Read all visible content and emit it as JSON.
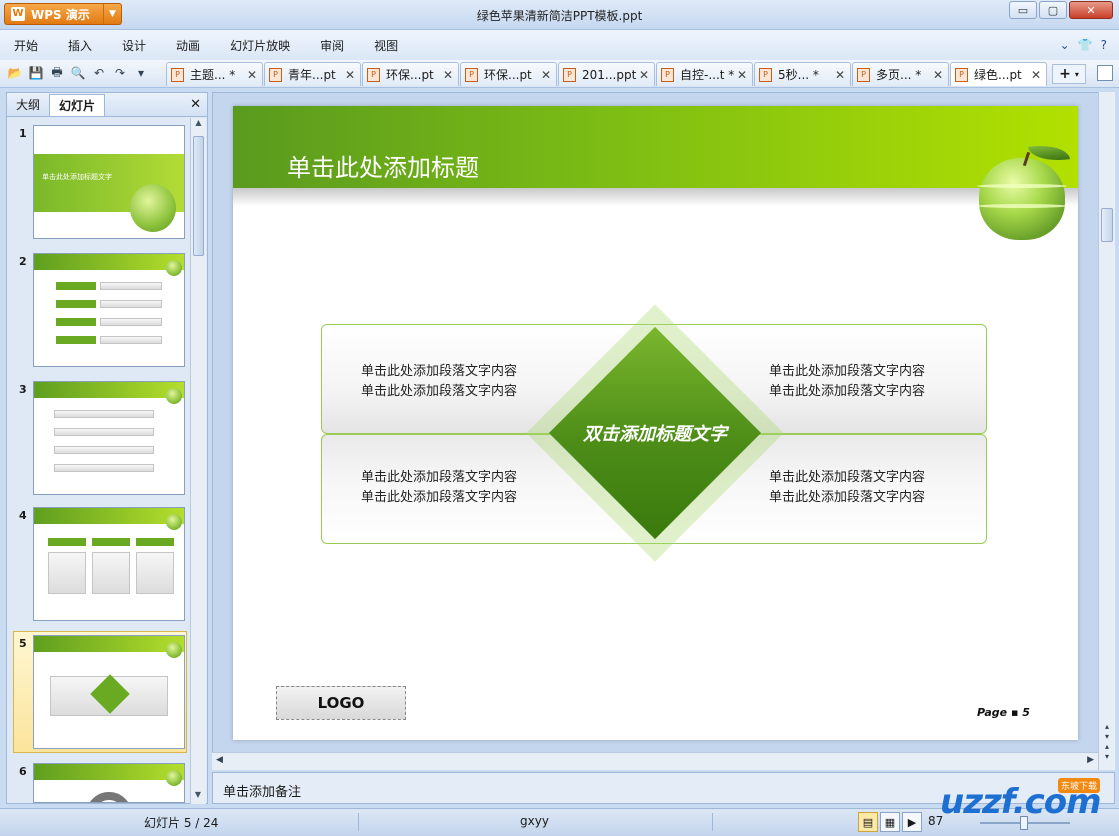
{
  "window": {
    "app_name": "WPS 演示",
    "title": "绿色苹果清新简洁PPT模板.ppt",
    "controls": {
      "minimize": "▭",
      "maximize": "▢",
      "close": "✕"
    }
  },
  "menu": {
    "items": [
      "开始",
      "插入",
      "设计",
      "动画",
      "幻灯片放映",
      "审阅",
      "视图"
    ],
    "right_icons": [
      "chevron-down-icon",
      "shirt-icon",
      "help-icon"
    ]
  },
  "doc_tabs": [
    {
      "label": "主题... *",
      "active": false
    },
    {
      "label": "青年...pt",
      "active": false
    },
    {
      "label": "环保...pt",
      "active": false
    },
    {
      "label": "环保...pt",
      "active": false
    },
    {
      "label": "201...ppt",
      "active": false
    },
    {
      "label": "自控-...t *",
      "active": false
    },
    {
      "label": "5秒... *",
      "active": false
    },
    {
      "label": "多页... *",
      "active": false
    },
    {
      "label": "绿色...pt",
      "active": true
    }
  ],
  "left_panel": {
    "tabs": [
      "大纲",
      "幻灯片"
    ],
    "active_tab": "幻灯片",
    "thumbnails": [
      "1",
      "2",
      "3",
      "4",
      "5",
      "6"
    ],
    "selected": "5",
    "thumb1_text": "单击此处添加标题文字"
  },
  "slide": {
    "title": "单击此处添加标题",
    "center_text": "双击添加标题文字",
    "para_tl": [
      "单击此处添加段落文字内容",
      "单击此处添加段落文字内容"
    ],
    "para_tr": [
      "单击此处添加段落文字内容",
      "单击此处添加段落文字内容"
    ],
    "para_bl": [
      "单击此处添加段落文字内容",
      "单击此处添加段落文字内容"
    ],
    "para_br": [
      "单击此处添加段落文字内容",
      "单击此处添加段落文字内容"
    ],
    "logo": "LOGO",
    "page_label": "Page ▪ 5"
  },
  "notes": {
    "placeholder": "单击添加备注"
  },
  "status": {
    "slide_info": "幻灯片 5 / 24",
    "theme": "gxyy",
    "zoom": "87"
  },
  "watermark": {
    "logo": "uzzf.com",
    "tag": "东坡下载"
  },
  "colors": {
    "accent_green": "#7dbd14",
    "dark_green": "#4c8c17",
    "wps_orange": "#e27a12"
  }
}
